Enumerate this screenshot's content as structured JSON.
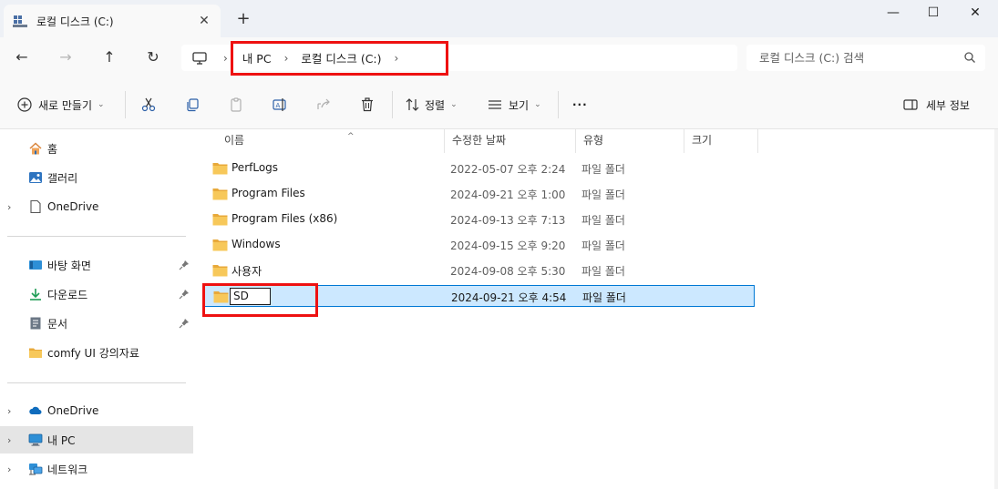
{
  "tab": {
    "title": "로컬 디스크 (C:)",
    "close": "✕",
    "new_tab": "+"
  },
  "window_controls": {
    "minimize": "—",
    "maximize": "☐",
    "close": "✕"
  },
  "nav": {
    "back": "←",
    "forward": "→",
    "up": "↑",
    "refresh": "↻"
  },
  "breadcrumb": [
    "내 PC",
    "로컬 디스크 (C:)"
  ],
  "chevron": "›",
  "search": {
    "placeholder": "로컬 디스크 (C:) 검색"
  },
  "commands": {
    "new": "새로 만들기",
    "sort": "정렬",
    "view": "보기",
    "more": "···",
    "details": "세부 정보",
    "caret": "⌄"
  },
  "sidebar": {
    "expander": "›",
    "top": [
      {
        "label": "홈"
      },
      {
        "label": "갤러리"
      },
      {
        "label": "OneDrive"
      }
    ],
    "quick": [
      {
        "label": "바탕 화면"
      },
      {
        "label": "다운로드"
      },
      {
        "label": "문서"
      },
      {
        "label": "comfy UI 강의자료"
      }
    ],
    "bottom": [
      {
        "label": "OneDrive"
      },
      {
        "label": "내 PC"
      },
      {
        "label": "네트워크"
      }
    ]
  },
  "columns": {
    "name": "이름",
    "modified": "수정한 날짜",
    "type": "유형",
    "size": "크기",
    "sort_indicator": "^"
  },
  "files": [
    {
      "name": "PerfLogs",
      "modified": "2022-05-07 오후 2:24",
      "type": "파일 폴더"
    },
    {
      "name": "Program Files",
      "modified": "2024-09-21 오후 1:00",
      "type": "파일 폴더"
    },
    {
      "name": "Program Files (x86)",
      "modified": "2024-09-13 오후 7:13",
      "type": "파일 폴더"
    },
    {
      "name": "Windows",
      "modified": "2024-09-15 오후 9:20",
      "type": "파일 폴더"
    },
    {
      "name": "사용자",
      "modified": "2024-09-08 오후 5:30",
      "type": "파일 폴더"
    },
    {
      "name": "SD",
      "modified": "2024-09-21 오후 4:54",
      "type": "파일 폴더"
    }
  ],
  "colors": {
    "accent": "#0078d4",
    "selection": "#cce8ff",
    "highlight_box": "#ee1111",
    "folder": "#f5c242"
  }
}
